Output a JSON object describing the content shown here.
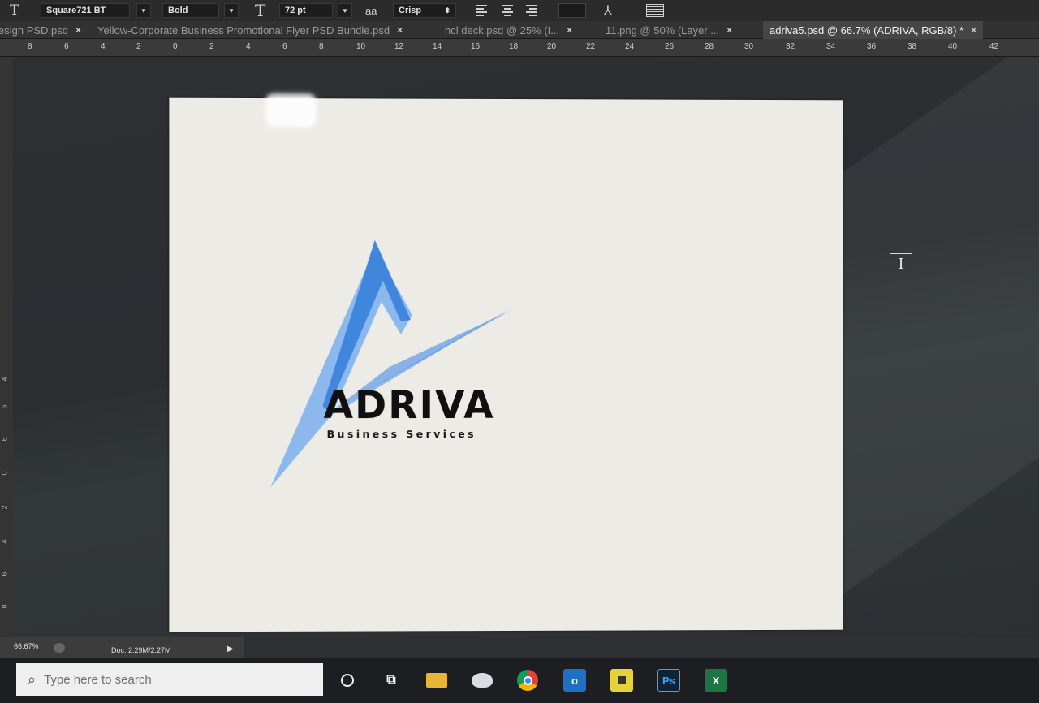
{
  "options_bar": {
    "font_family": "Square721 BT",
    "font_style": "Bold",
    "font_size": "72 pt",
    "antialias_label": "aa",
    "antialias": "Crisp"
  },
  "tabs": [
    {
      "label": "esign PSD.psd",
      "active": false
    },
    {
      "label": "Yellow-Corporate Business Promotional Flyer PSD Bundle.psd",
      "active": false
    },
    {
      "label": "hcl deck.psd @ 25% (I...",
      "active": false
    },
    {
      "label": "11.png @ 50% (Layer ...",
      "active": false
    },
    {
      "label": "adriva5.psd @ 66.7% (ADRIVA, RGB/8) *",
      "active": true
    }
  ],
  "ruler": {
    "numbers": [
      "8",
      "6",
      "4",
      "2",
      "0",
      "2",
      "4",
      "6",
      "8",
      "10",
      "12",
      "14",
      "16",
      "18",
      "20",
      "22",
      "24",
      "26",
      "28",
      "30",
      "32",
      "34",
      "36",
      "38",
      "40",
      "42"
    ]
  },
  "vertical_ruler": {
    "numbers": [
      "4",
      "6",
      "8",
      "0",
      "2",
      "4",
      "6",
      "8"
    ]
  },
  "document": {
    "logo_word": "ADRIVA",
    "logo_tagline": "Business Services",
    "logo_colors": {
      "dark_blue": "#3f86dc",
      "light_blue": "#8cb8ee"
    }
  },
  "status_bar": {
    "zoom": "66.67%",
    "doc_info": "Doc: 2.29M/2.27M"
  },
  "taskbar": {
    "search_placeholder": "Type here to search",
    "icons": [
      "cortana-icon",
      "task-view-icon",
      "file-explorer-icon",
      "paint-icon",
      "chrome-icon",
      "outlook-icon",
      "sticky-notes-icon",
      "photoshop-icon",
      "excel-icon"
    ],
    "photoshop_label": "Ps",
    "excel_label": "X"
  }
}
